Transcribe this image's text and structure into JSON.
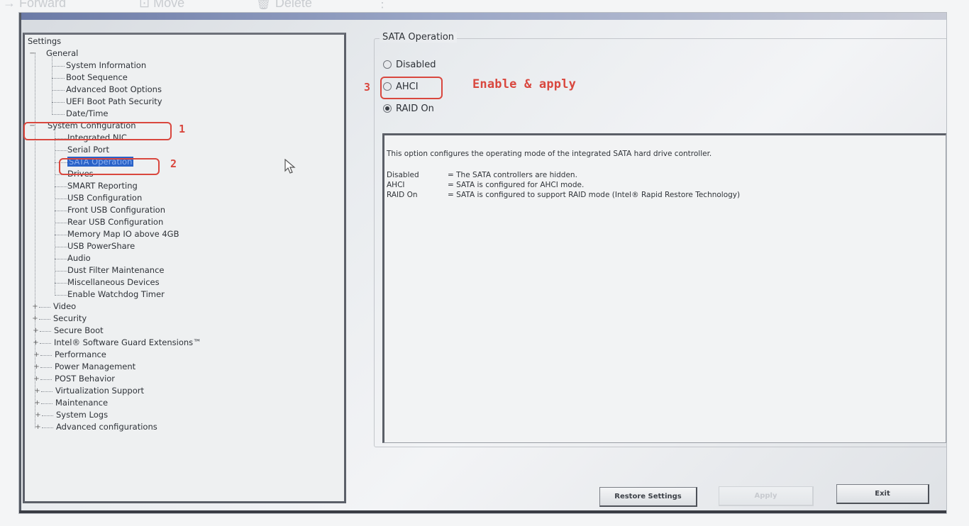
{
  "background_toolbar": {
    "forward": "→ Forward",
    "move": "⊡ Move",
    "delete": "🗑 Delete",
    "more": "⋮"
  },
  "tree": {
    "root": "Settings",
    "general": {
      "label": "General",
      "children": [
        "System Information",
        "Boot Sequence",
        "Advanced Boot Options",
        "UEFI Boot Path Security",
        "Date/Time"
      ]
    },
    "system_configuration": {
      "label": "System Configuration",
      "children": [
        "Integrated NIC",
        "Serial Port",
        "SATA Operation",
        "Drives",
        "SMART Reporting",
        "USB Configuration",
        "Front USB Configuration",
        "Rear USB Configuration",
        "Memory Map IO above 4GB",
        "USB PowerShare",
        "Audio",
        "Dust Filter Maintenance",
        "Miscellaneous Devices",
        "Enable Watchdog Timer"
      ],
      "selected": "SATA Operation"
    },
    "collapsed": [
      "Video",
      "Security",
      "Secure Boot",
      "Intel® Software Guard Extensions™",
      "Performance",
      "Power Management",
      "POST Behavior",
      "Virtualization Support",
      "Maintenance",
      "System Logs",
      "Advanced configurations"
    ]
  },
  "annotations": {
    "step1": "1",
    "step2": "2",
    "step3": "3",
    "enable_apply": "Enable & apply",
    "color": "#d9473e"
  },
  "sata": {
    "group_title": "SATA Operation",
    "options": [
      {
        "label": "Disabled",
        "checked": false
      },
      {
        "label": "AHCI",
        "checked": false
      },
      {
        "label": "RAID On",
        "checked": true
      }
    ],
    "description": {
      "intro": "This option configures the operating mode of the integrated SATA hard drive controller.",
      "rows": [
        {
          "term": "Disabled",
          "text": "= The SATA controllers are hidden."
        },
        {
          "term": "AHCI",
          "text": "= SATA is configured for AHCI mode."
        },
        {
          "term": "RAID On",
          "text": "= SATA is configured to support RAID mode (Intel® Rapid Restore Technology)"
        }
      ]
    }
  },
  "buttons": {
    "restore": "Restore Settings",
    "apply": "Apply",
    "exit": "Exit"
  }
}
